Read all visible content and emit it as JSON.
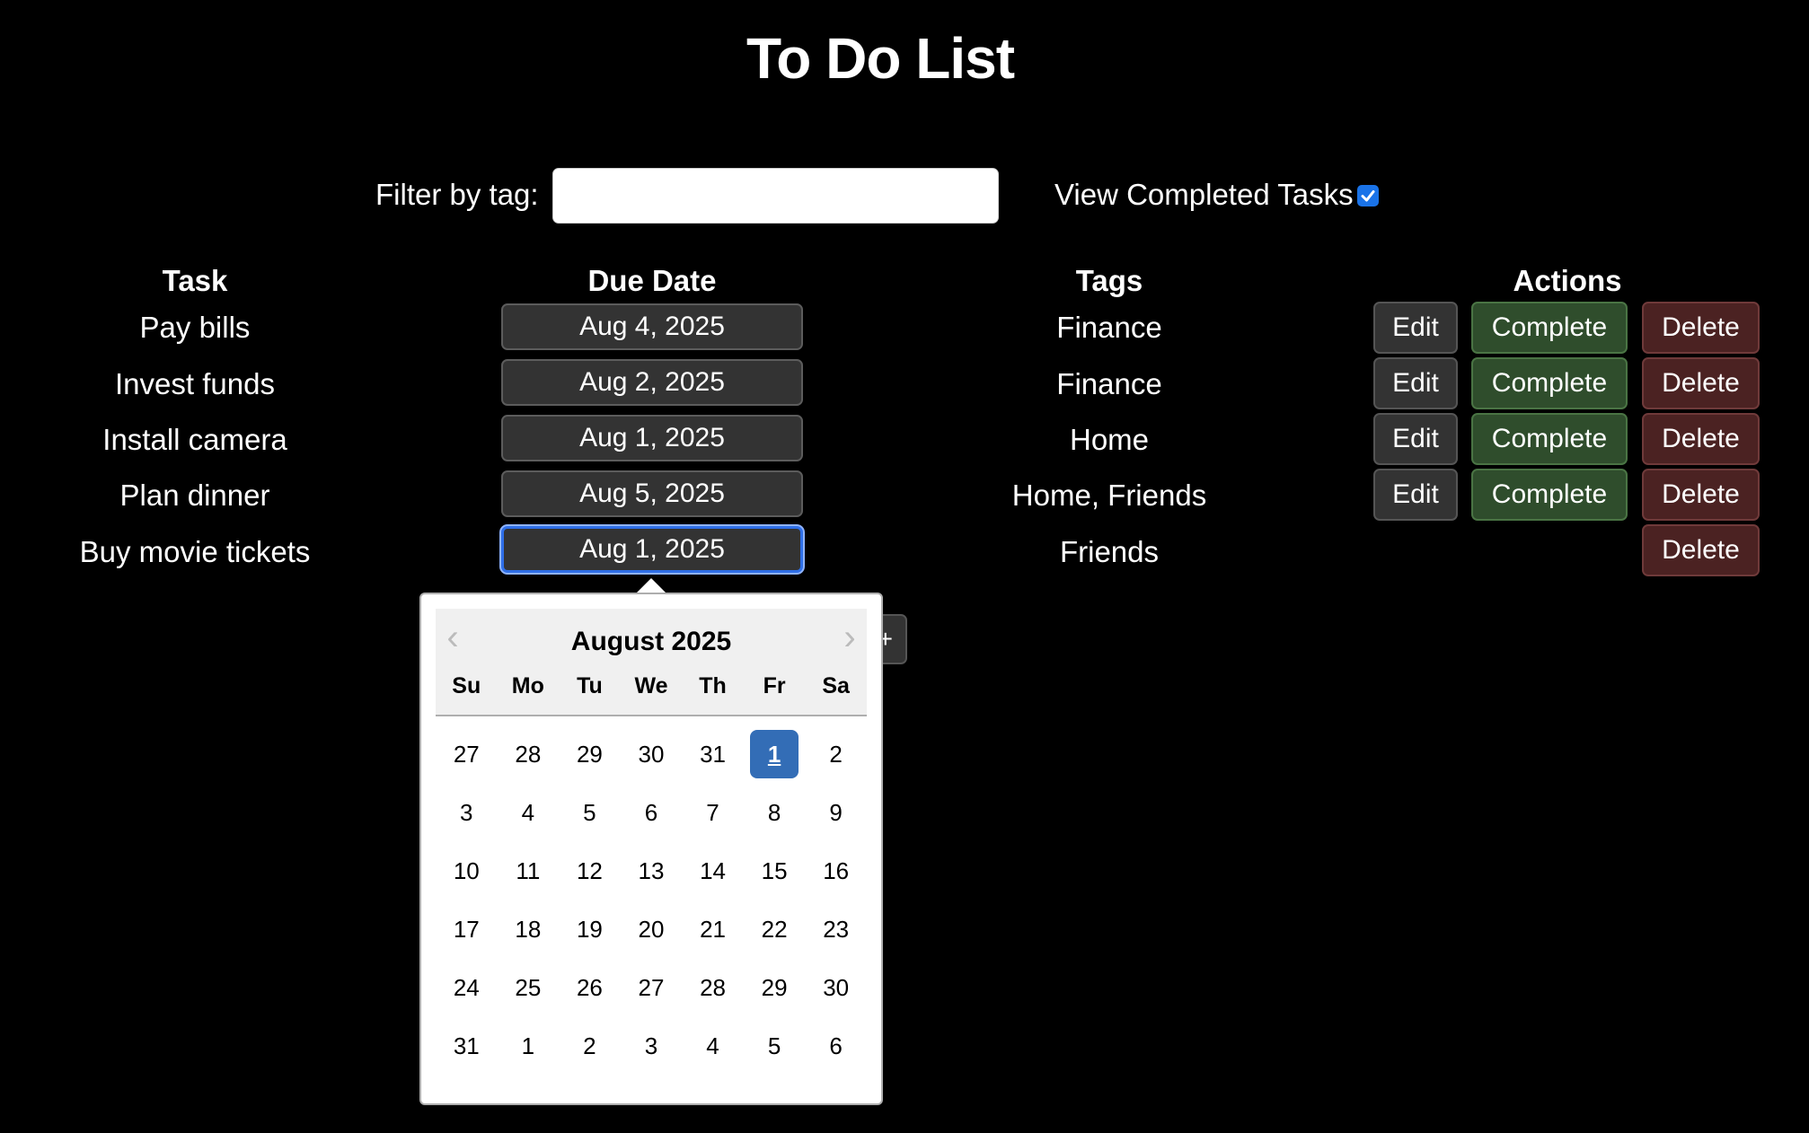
{
  "title": "To Do List",
  "filter": {
    "label": "Filter by tag:",
    "value": "",
    "placeholder": ""
  },
  "view_completed": {
    "label": "View Completed Tasks",
    "checked": true
  },
  "columns": {
    "task": "Task",
    "due": "Due Date",
    "tags": "Tags",
    "actions": "Actions"
  },
  "actions": {
    "edit": "Edit",
    "complete": "Complete",
    "delete": "Delete"
  },
  "tasks": [
    {
      "name": "Pay bills",
      "due": "Aug 4, 2025",
      "tags": "Finance"
    },
    {
      "name": "Invest funds",
      "due": "Aug 2, 2025",
      "tags": "Finance"
    },
    {
      "name": "Install camera",
      "due": "Aug 1, 2025",
      "tags": "Home"
    },
    {
      "name": "Plan dinner",
      "due": "Aug 5, 2025",
      "tags": "Home, Friends"
    },
    {
      "name": "Buy movie tickets",
      "due": "Aug 1, 2025",
      "tags": "Friends",
      "completed": true
    }
  ],
  "hidden_button_label": "+",
  "calendar": {
    "month": "August 2025",
    "weekdays": [
      "Su",
      "Mo",
      "Tu",
      "We",
      "Th",
      "Fr",
      "Sa"
    ],
    "days": [
      "27",
      "28",
      "29",
      "30",
      "31",
      "1",
      "2",
      "3",
      "4",
      "5",
      "6",
      "7",
      "8",
      "9",
      "10",
      "11",
      "12",
      "13",
      "14",
      "15",
      "16",
      "17",
      "18",
      "19",
      "20",
      "21",
      "22",
      "23",
      "24",
      "25",
      "26",
      "27",
      "28",
      "29",
      "30",
      "31",
      "1",
      "2",
      "3",
      "4",
      "5",
      "6"
    ],
    "selected_day": "1",
    "prev_icon": "chevron-left-icon",
    "next_icon": "chevron-right-icon"
  },
  "colors": {
    "background": "#000000",
    "complete": "#2f4d2c",
    "delete": "#4b2222",
    "selected_day": "#336db6",
    "focus": "#2f6fe8"
  }
}
